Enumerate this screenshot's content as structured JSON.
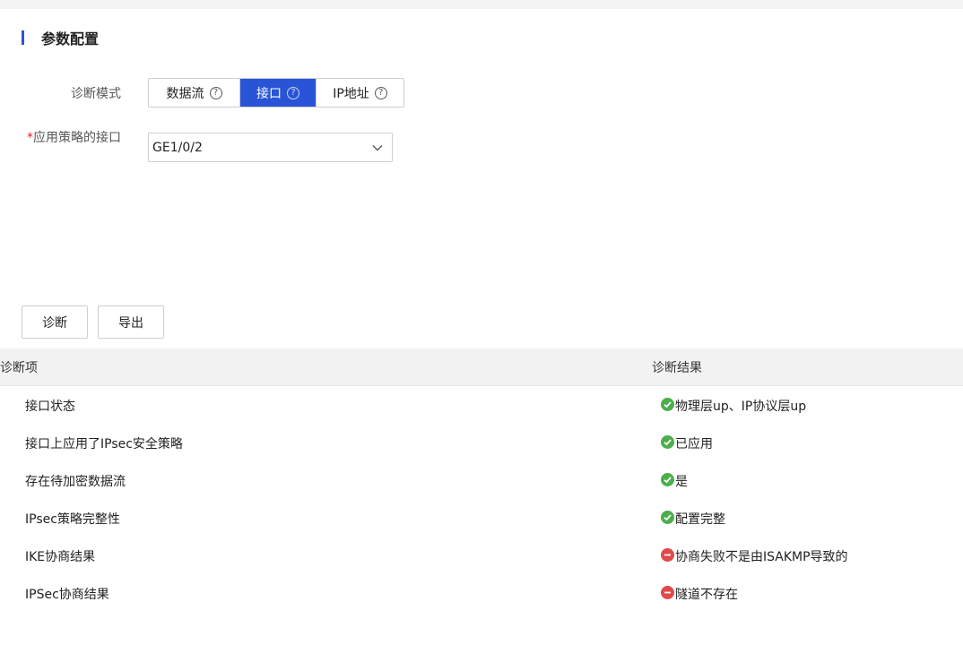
{
  "section": {
    "title": "参数配置"
  },
  "form": {
    "mode_label": "诊断模式",
    "mode_options": [
      "数据流",
      "接口",
      "IP地址"
    ],
    "mode_selected": "接口",
    "help_glyph": "?",
    "required_mark": "*",
    "iface_label": "应用策略的接口",
    "iface_value": "GE1/0/2"
  },
  "actions": {
    "diagnose": "诊断",
    "export": "导出"
  },
  "table": {
    "col_item": "诊断项",
    "col_result": "诊断结果",
    "rows": [
      {
        "item": "接口状态",
        "status": "ok",
        "result": "物理层up、IP协议层up"
      },
      {
        "item": "接口上应用了IPsec安全策略",
        "status": "ok",
        "result": "已应用"
      },
      {
        "item": "存在待加密数据流",
        "status": "ok",
        "result": "是"
      },
      {
        "item": "IPsec策略完整性",
        "status": "ok",
        "result": "配置完整"
      },
      {
        "item": "IKE协商结果",
        "status": "error",
        "result": "协商失败不是由ISAKMP导致的"
      },
      {
        "item": "IPSec协商结果",
        "status": "error",
        "result": "隧道不存在"
      }
    ]
  },
  "colors": {
    "accent": "#2a54d6",
    "ok": "#4cae4c",
    "error": "#e04a4a"
  },
  "icons": {
    "help": "question-circle-icon",
    "select": "chevron-down-icon",
    "ok": "check-circle-icon",
    "error": "minus-circle-icon"
  }
}
